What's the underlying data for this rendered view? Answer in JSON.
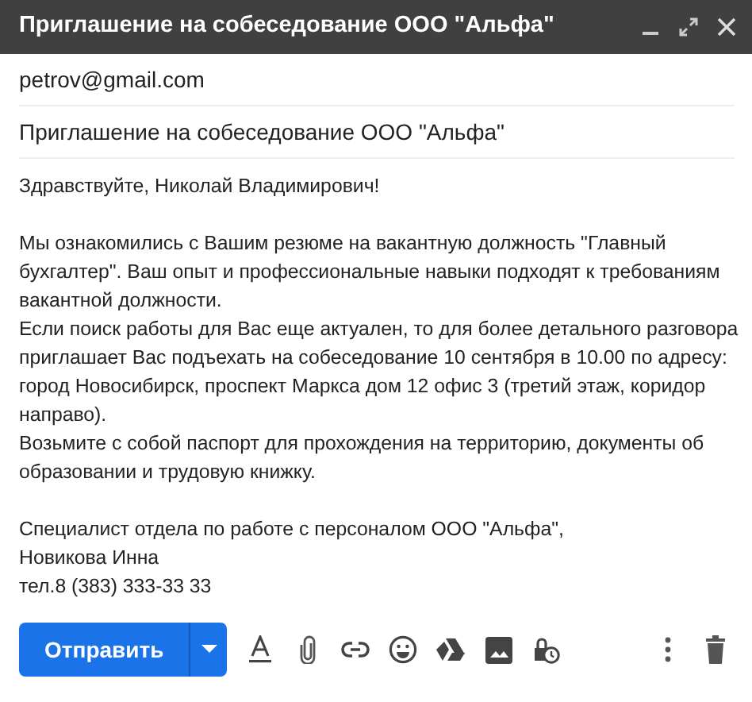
{
  "window": {
    "title": "Приглашение на собеседование ООО \"Альфа\""
  },
  "to": {
    "value": "petrov@gmail.com"
  },
  "subject": {
    "value": "Приглашение на собеседование ООО \"Альфа\""
  },
  "body": [
    {
      "lines": [
        "Здравствуйте, Николай Владимирович!"
      ]
    },
    {
      "lines": [
        "Мы ознакомились с Вашим резюме на вакантную должность \"Главный",
        "бухгалтер\". Ваш опыт и профессиональные навыки подходят к требованиям",
        "вакантной должности.",
        "Если поиск работы для Вас еще актуален, то для более детального разговора",
        "приглашает Вас подъехать на собеседование 10 сентября в 10.00 по адресу:",
        "город Новосибирск, проспект Маркса дом 12 офис 3 (третий этаж, коридор",
        "направо).",
        "Возьмите с собой паспорт для прохождения на территорию, документы об",
        "образовании и трудовую книжку."
      ]
    },
    {
      "lines": [
        "Специалист отдела по работе с персоналом ООО \"Альфа\",",
        "Новикова Инна",
        "тел.8 (383) 333-33 33"
      ]
    }
  ],
  "send_button": {
    "label": "Отправить"
  }
}
